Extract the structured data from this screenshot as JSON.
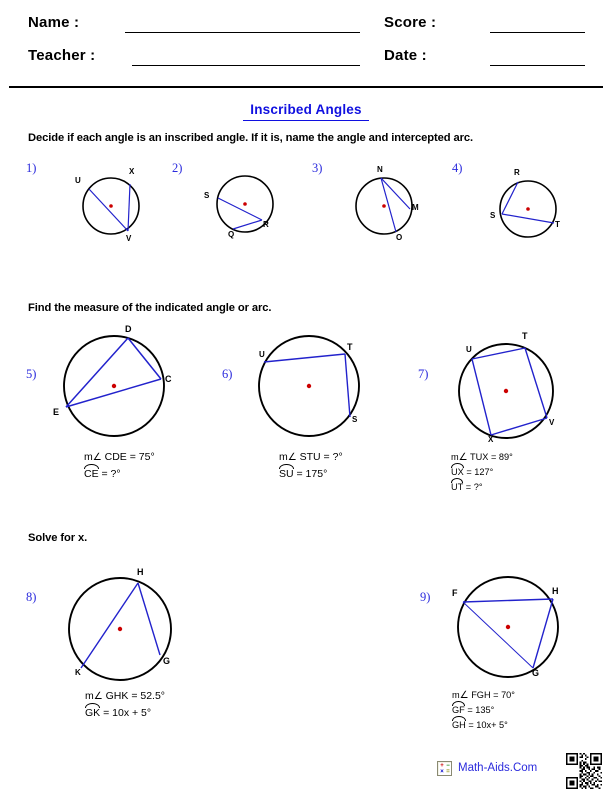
{
  "header": {
    "name_label": "Name :",
    "teacher_label": "Teacher :",
    "score_label": "Score :",
    "date_label": "Date :"
  },
  "title": "Inscribed Angles",
  "sections": [
    {
      "instruction": "Decide if each angle is an inscribed angle. If it is, name the angle and intercepted arc."
    },
    {
      "instruction": "Find the measure of the indicated angle or arc."
    },
    {
      "instruction": "Solve for x."
    }
  ],
  "problems": [
    {
      "number": "1)",
      "points": [
        "U",
        "X",
        "V"
      ],
      "equations": []
    },
    {
      "number": "2)",
      "points": [
        "S",
        "R",
        "Q"
      ],
      "equations": []
    },
    {
      "number": "3)",
      "points": [
        "N",
        "M",
        "O"
      ],
      "equations": []
    },
    {
      "number": "4)",
      "points": [
        "R",
        "S",
        "T"
      ],
      "equations": []
    },
    {
      "number": "5)",
      "points": [
        "D",
        "C",
        "E"
      ],
      "equations": [
        {
          "prefix": "m",
          "angle": true,
          "name": "CDE",
          "value": " = 75°"
        },
        {
          "prefix": "",
          "arc": true,
          "name": "CE",
          "value": " = ?°"
        }
      ]
    },
    {
      "number": "6)",
      "points": [
        "U",
        "T",
        "S"
      ],
      "equations": [
        {
          "prefix": "m",
          "angle": true,
          "name": "STU",
          "value": " = ?°"
        },
        {
          "prefix": "",
          "arc": true,
          "name": "SU",
          "value": " = 175°"
        }
      ]
    },
    {
      "number": "7)",
      "points": [
        "U",
        "T",
        "V",
        "X"
      ],
      "equations": [
        {
          "prefix": "m",
          "angle": true,
          "name": "TUX",
          "value": " = 89°"
        },
        {
          "prefix": "",
          "arc": true,
          "name": "UX",
          "value": " = 127°"
        },
        {
          "prefix": "",
          "arc": true,
          "name": "UT",
          "value": " = ?°"
        }
      ]
    },
    {
      "number": "8)",
      "points": [
        "H",
        "G",
        "K"
      ],
      "equations": [
        {
          "prefix": "m",
          "angle": true,
          "name": "GHK",
          "value": " = 52.5°"
        },
        {
          "prefix": "",
          "arc": true,
          "name": "GK",
          "value": " = 10x + 5°"
        }
      ]
    },
    {
      "number": "9)",
      "points": [
        "F",
        "H",
        "G"
      ],
      "equations": [
        {
          "prefix": "m",
          "angle": true,
          "name": "FGH",
          "value": " = 70°"
        },
        {
          "prefix": "",
          "arc": true,
          "name": "GF",
          "value": " = 135°"
        },
        {
          "prefix": "",
          "arc": true,
          "name": "GH",
          "value": " = 10x+ 5°"
        }
      ]
    }
  ],
  "footer": {
    "site": "Math-Aids.Com",
    "calc_keys": [
      "+",
      "−",
      "×",
      "="
    ]
  },
  "colors": {
    "chord": "#2222cc",
    "circle": "#000000",
    "center_dot": "#cc0000",
    "accent": "#1010e0",
    "problem_number": "#2b2bdd"
  }
}
